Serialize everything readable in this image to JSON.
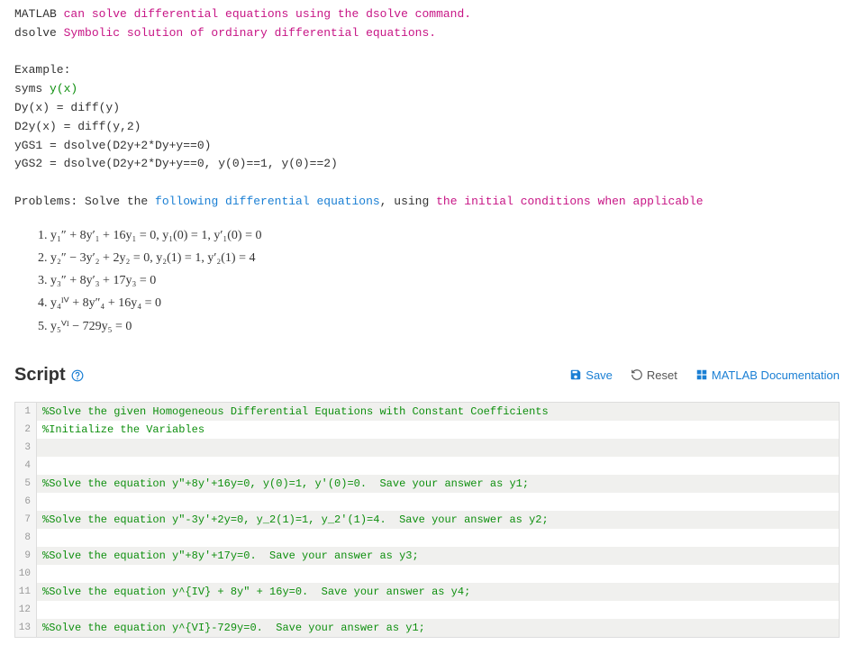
{
  "intro": {
    "line1_pre": "MATLAB ",
    "line1_link": "can solve differential equations using the dsolve command.",
    "line2_pre": "dsolve ",
    "line2_link": "Symbolic solution of ordinary differential equations."
  },
  "example": {
    "title": "Example:",
    "l1_pre": "syms ",
    "l1_func": "y(x)",
    "l2": "Dy(x) = diff(y)",
    "l3": "D2y(x) = diff(y,2)",
    "l4": "yGS1 = dsolve(D2y+2*Dy+y==0)",
    "l5": "yGS2 = dsolve(D2y+2*Dy+y==0, y(0)==1, y(0)==2)"
  },
  "problems": {
    "intro_pre": "Problems: Solve the ",
    "intro_link1": "following differential equations",
    "intro_mid": ", using ",
    "intro_link2": "the initial conditions when applicable",
    "items": [
      "y₁″ + 8y′₁ + 16y₁ = 0, y₁(0) = 1, y′₁(0) = 0",
      "y₂″ − 3y′₂ + 2y₂ = 0, y₂(1) = 1, y′₂(1) = 4",
      "y₃″ + 8y′₃ + 17y₃ = 0",
      "y₄ᴵⱽ + 8y″₄ + 16y₄ = 0",
      "y₅ⱽᴵ − 729y₅ = 0"
    ]
  },
  "script": {
    "title": "Script",
    "save": "Save",
    "reset": "Reset",
    "docs": "MATLAB Documentation"
  },
  "editor_lines": [
    "%Solve the given Homogeneous Differential Equations with Constant Coefficients",
    "%Initialize the Variables",
    "",
    "",
    "%Solve the equation y\"+8y'+16y=0, y(0)=1, y'(0)=0.  Save your answer as y1;",
    "",
    "%Solve the equation y\"-3y'+2y=0, y_2(1)=1, y_2'(1)=4.  Save your answer as y2;",
    "",
    "%Solve the equation y\"+8y'+17y=0.  Save your answer as y3;",
    "",
    "%Solve the equation y^{IV} + 8y\" + 16y=0.  Save your answer as y4;",
    "",
    "%Solve the equation y^{VI}-729y=0.  Save your answer as y1;"
  ]
}
